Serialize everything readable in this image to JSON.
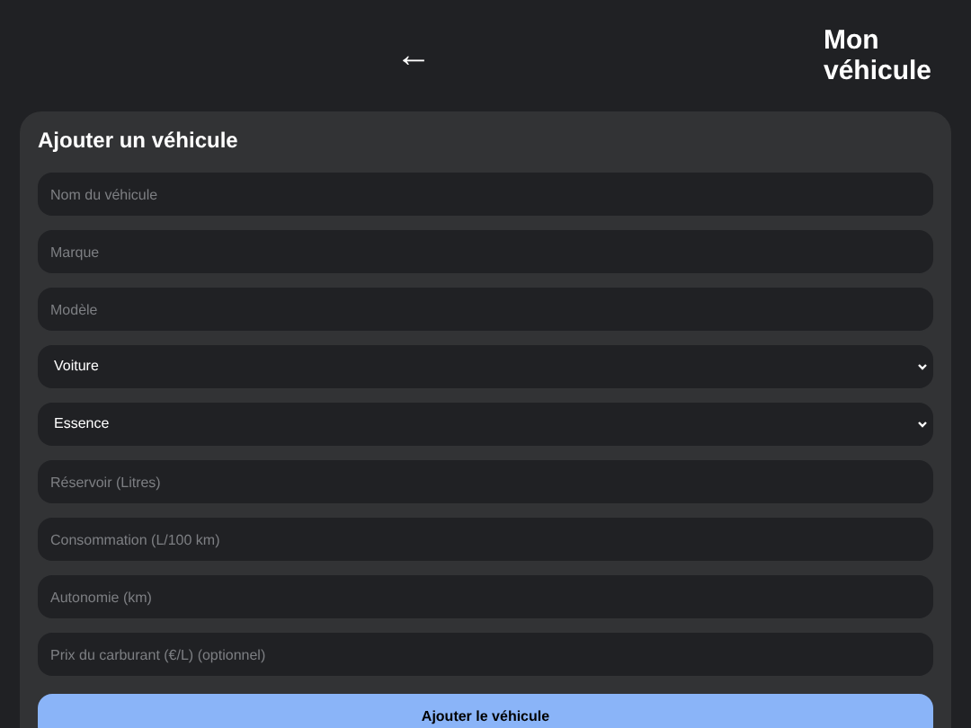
{
  "header": {
    "back": "←",
    "title": "Mon véhicule"
  },
  "form": {
    "title": "Ajouter un véhicule",
    "fields": [
      {
        "kind": "input",
        "placeholder": "Nom du véhicule"
      },
      {
        "kind": "input",
        "placeholder": "Marque"
      },
      {
        "kind": "input",
        "placeholder": "Modèle"
      },
      {
        "kind": "select",
        "value": "Voiture"
      },
      {
        "kind": "select",
        "value": "Essence"
      },
      {
        "kind": "input",
        "placeholder": "Réservoir (Litres)"
      },
      {
        "kind": "input",
        "placeholder": "Consommation (L/100 km)"
      },
      {
        "kind": "input",
        "placeholder": "Autonomie (km)"
      },
      {
        "kind": "input",
        "placeholder": "Prix du carburant (€/L) (optionnel)"
      }
    ],
    "submit": "Ajouter le véhicule"
  }
}
